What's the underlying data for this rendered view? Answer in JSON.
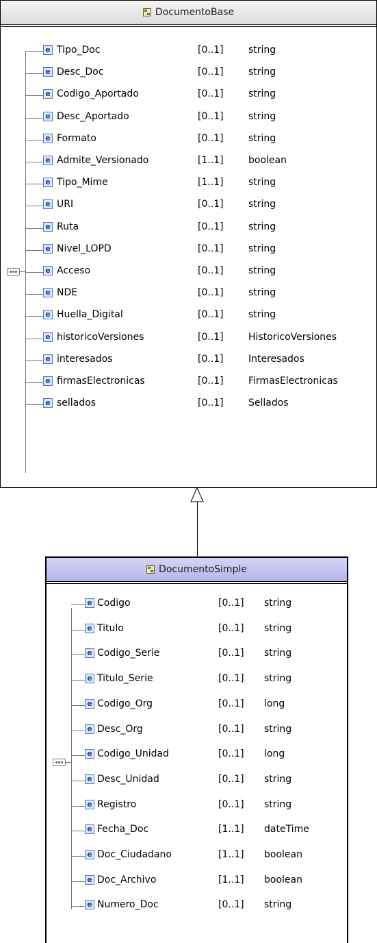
{
  "base": {
    "title": "DocumentoBase",
    "elements": [
      {
        "name": "Tipo_Doc",
        "mult": "[0..1]",
        "type": "string"
      },
      {
        "name": "Desc_Doc",
        "mult": "[0..1]",
        "type": "string"
      },
      {
        "name": "Codigo_Aportado",
        "mult": "[0..1]",
        "type": "string"
      },
      {
        "name": "Desc_Aportado",
        "mult": "[0..1]",
        "type": "string"
      },
      {
        "name": "Formato",
        "mult": "[0..1]",
        "type": "string"
      },
      {
        "name": "Admite_Versionado",
        "mult": "[1..1]",
        "type": "boolean"
      },
      {
        "name": "Tipo_Mime",
        "mult": "[1..1]",
        "type": "string"
      },
      {
        "name": "URI",
        "mult": "[0..1]",
        "type": "string"
      },
      {
        "name": "Ruta",
        "mult": "[0..1]",
        "type": "string"
      },
      {
        "name": "Nivel_LOPD",
        "mult": "[0..1]",
        "type": "string"
      },
      {
        "name": "Acceso",
        "mult": "[0..1]",
        "type": "string"
      },
      {
        "name": "NDE",
        "mult": "[0..1]",
        "type": "string"
      },
      {
        "name": "Huella_Digital",
        "mult": "[0..1]",
        "type": "string"
      },
      {
        "name": "historicoVersiones",
        "mult": "[0..1]",
        "type": "HistoricoVersiones"
      },
      {
        "name": "interesados",
        "mult": "[0..1]",
        "type": "Interesados"
      },
      {
        "name": "firmasElectronicas",
        "mult": "[0..1]",
        "type": "FirmasElectronicas"
      },
      {
        "name": "sellados",
        "mult": "[0..1]",
        "type": "Sellados"
      }
    ]
  },
  "simple": {
    "title": "DocumentoSimple",
    "elements": [
      {
        "name": "Codigo",
        "mult": "[0..1]",
        "type": "string"
      },
      {
        "name": "Titulo",
        "mult": "[0..1]",
        "type": "string"
      },
      {
        "name": "Codigo_Serie",
        "mult": "[0..1]",
        "type": "string"
      },
      {
        "name": "Titulo_Serie",
        "mult": "[0..1]",
        "type": "string"
      },
      {
        "name": "Codigo_Org",
        "mult": "[0..1]",
        "type": "long"
      },
      {
        "name": "Desc_Org",
        "mult": "[0..1]",
        "type": "string"
      },
      {
        "name": "Codigo_Unidad",
        "mult": "[0..1]",
        "type": "long"
      },
      {
        "name": "Desc_Unidad",
        "mult": "[0..1]",
        "type": "string"
      },
      {
        "name": "Registro",
        "mult": "[0..1]",
        "type": "string"
      },
      {
        "name": "Fecha_Doc",
        "mult": "[1..1]",
        "type": "dateTime"
      },
      {
        "name": "Doc_Ciudadano",
        "mult": "[1..1]",
        "type": "boolean"
      },
      {
        "name": "Doc_Archivo",
        "mult": "[1..1]",
        "type": "boolean"
      },
      {
        "name": "Numero_Doc",
        "mult": "[0..1]",
        "type": "string"
      }
    ]
  },
  "element_icon_letter": "e",
  "colors": {
    "base_header": "#dcdcdc",
    "simple_header": "#b4b4ec",
    "element_icon": "#1f3f87"
  }
}
